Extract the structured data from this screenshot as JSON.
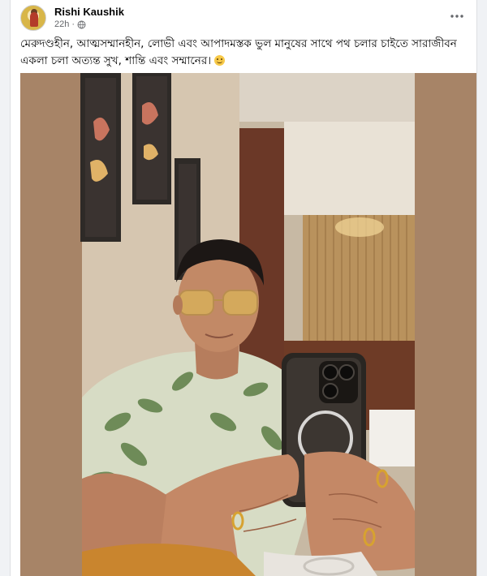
{
  "post": {
    "author": "Rishi Kaushik",
    "time": "22h",
    "dot": "·",
    "more_icon": "more-options-icon",
    "audience_icon": "globe-icon",
    "text": "মেরুদণ্ডহীন, আত্মসম্মানহীন, লোভী এবং আপাদমস্তক ভুল মানুষের সাথে পথ চলার চাইতে সারাজীবন একলা চলা অত্যন্ত সুখ, শান্তি এবং সম্মানের।"
  },
  "colors": {
    "name": "#050505",
    "meta": "#65676b",
    "photo_background": "#a68468"
  }
}
